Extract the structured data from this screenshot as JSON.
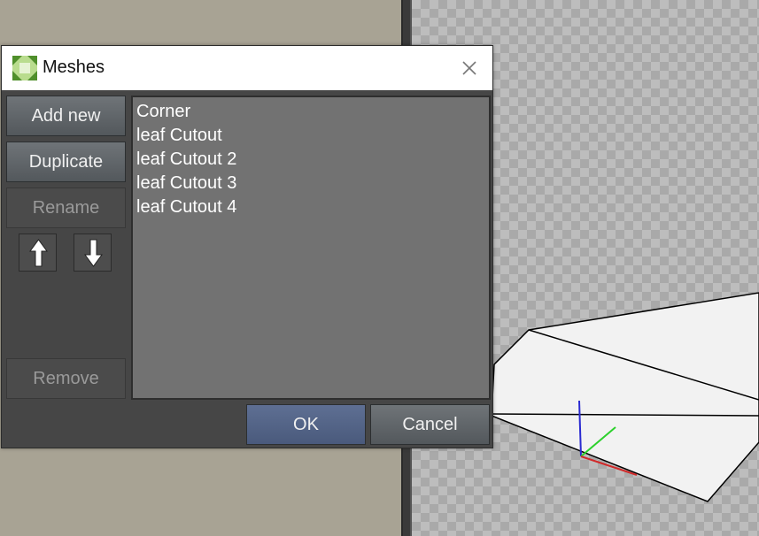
{
  "dialog": {
    "title": "Meshes",
    "buttons": {
      "add_new": "Add new",
      "duplicate": "Duplicate",
      "rename": "Rename",
      "remove": "Remove",
      "ok": "OK",
      "cancel": "Cancel"
    },
    "meshes": [
      "Corner",
      "leaf Cutout",
      "leaf Cutout 2",
      "leaf Cutout 3",
      "leaf Cutout 4"
    ]
  },
  "icons": {
    "app": "meshes-app-icon",
    "close": "close-icon",
    "move_up": "arrow-up-icon",
    "move_down": "arrow-down-icon"
  },
  "colors": {
    "dialog_bg": "#464646",
    "list_bg": "#727272",
    "ok_button": "#5e6f93",
    "canvas_bg": "#a8a394",
    "axis_x": "#d12a2a",
    "axis_y": "#2bd12b",
    "axis_z": "#2a2ad1"
  }
}
